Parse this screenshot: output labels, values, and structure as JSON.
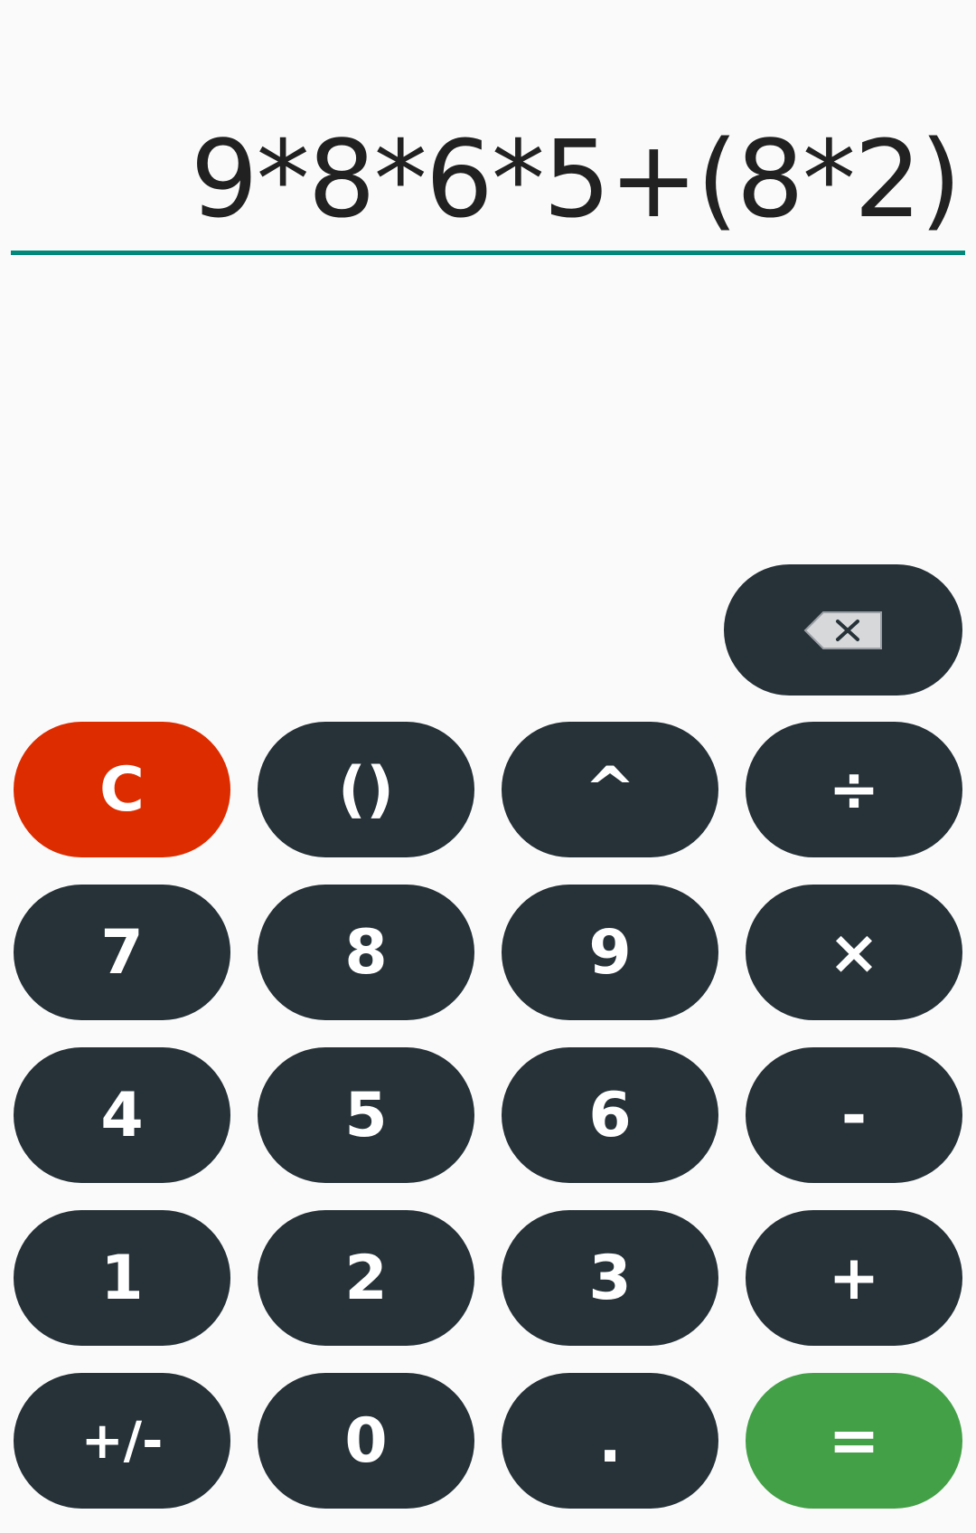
{
  "display": {
    "expression": "9*8*6*5+(8*2)"
  },
  "keypad": {
    "backspace_icon": "backspace-icon",
    "clear": "C",
    "parentheses": "()",
    "power": "^",
    "divide": "÷",
    "seven": "7",
    "eight": "8",
    "nine": "9",
    "multiply": "×",
    "four": "4",
    "five": "5",
    "six": "6",
    "minus": "-",
    "one": "1",
    "two": "2",
    "three": "3",
    "plus": "+",
    "negate": "+/-",
    "zero": "0",
    "decimal": ".",
    "equals": "="
  },
  "colors": {
    "accent_underline": "#00897b",
    "button": "#263238",
    "clear_button": "#dd2c00",
    "equals_button": "#43a047",
    "background": "#fafafa"
  }
}
